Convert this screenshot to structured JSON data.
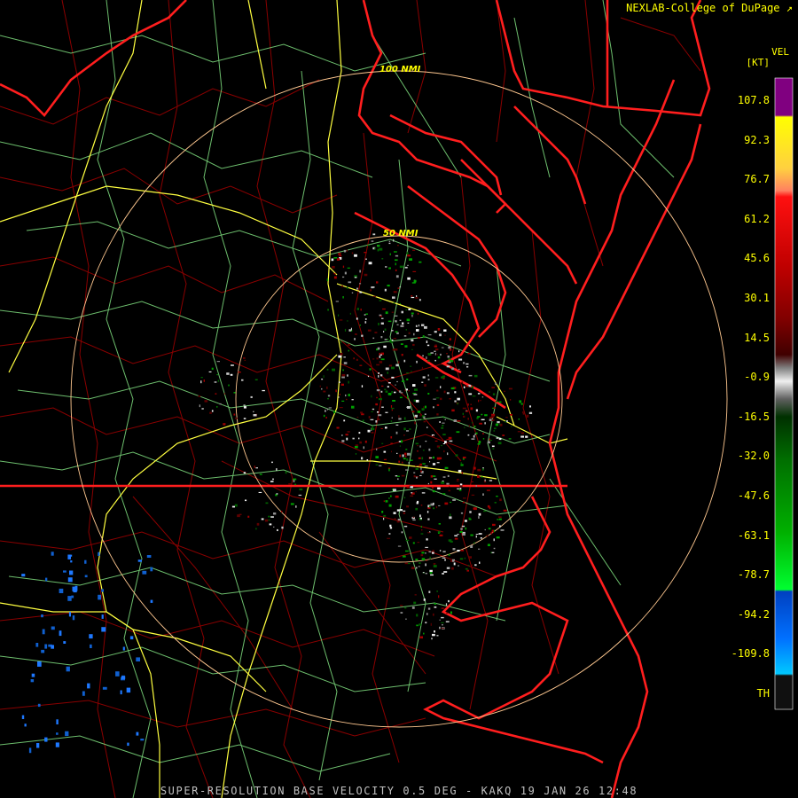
{
  "credit": "NEXLAB-College of DuPage",
  "caption": "SUPER-RESOLUTION BASE VELOCITY 0.5 DEG - KAKQ 19 JAN 26 12:48",
  "legend": {
    "product": "VEL",
    "unit": "[KT]",
    "ticks": [
      "107.8",
      "92.3",
      "76.7",
      "61.2",
      "45.6",
      "30.1",
      "14.5",
      "-0.9",
      "-16.5",
      "-32.0",
      "-47.6",
      "-63.1",
      "-78.7",
      "-94.2",
      "-109.8",
      "TH"
    ],
    "colors": [
      "#800080",
      "#ffff00",
      "#ff2020",
      "#ff0000",
      "#a00000",
      "#500000",
      "#c8c8c8",
      "#006000",
      "#00c800",
      "#0050ff",
      "#00c0ff"
    ]
  },
  "range_rings": [
    {
      "label": "100 NMI"
    },
    {
      "label": "50 NMI"
    }
  ],
  "colors": {
    "state_border": "#ff1e1e",
    "county_border": "#b00000",
    "highway": "#ffff40",
    "road": "#80e080",
    "range_ring": "#ffc890"
  }
}
